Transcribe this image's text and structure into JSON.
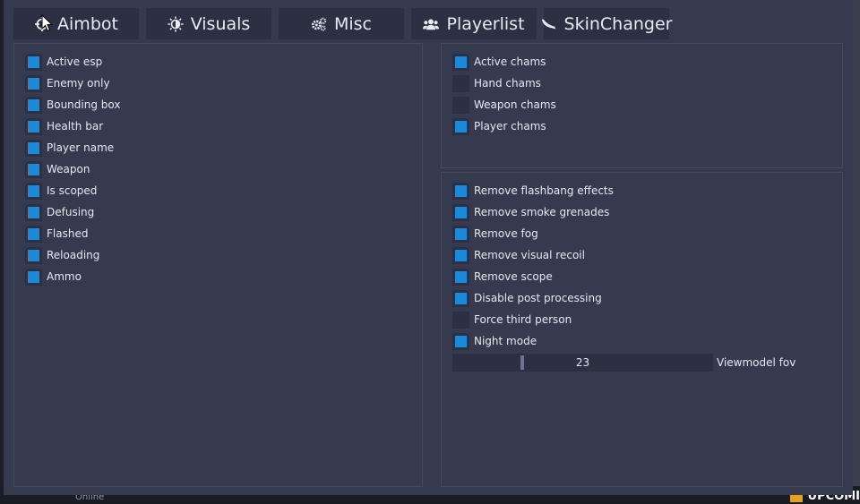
{
  "tabs": [
    {
      "label": "Aimbot",
      "icon": "crosshair-icon",
      "active": true
    },
    {
      "label": "Visuals",
      "icon": "sun-icon",
      "active": false
    },
    {
      "label": "Misc",
      "icon": "gears-icon",
      "active": false
    },
    {
      "label": "Playerlist",
      "icon": "users-icon",
      "active": false
    },
    {
      "label": "SkinChanger",
      "icon": "knife-icon",
      "active": false
    }
  ],
  "esp": [
    {
      "label": "Active esp",
      "checked": true
    },
    {
      "label": "Enemy only",
      "checked": true
    },
    {
      "label": "Bounding box",
      "checked": true
    },
    {
      "label": "Health bar",
      "checked": true
    },
    {
      "label": "Player name",
      "checked": true
    },
    {
      "label": "Weapon",
      "checked": true
    },
    {
      "label": "Is scoped",
      "checked": true
    },
    {
      "label": "Defusing",
      "checked": true
    },
    {
      "label": "Flashed",
      "checked": true
    },
    {
      "label": "Reloading",
      "checked": true
    },
    {
      "label": "Ammo",
      "checked": true
    }
  ],
  "chams": [
    {
      "label": "Active chams",
      "checked": true
    },
    {
      "label": "Hand chams",
      "checked": false
    },
    {
      "label": "Weapon chams",
      "checked": false
    },
    {
      "label": "Player chams",
      "checked": true
    }
  ],
  "removals": [
    {
      "label": "Remove flashbang effects",
      "checked": true
    },
    {
      "label": "Remove smoke grenades",
      "checked": true
    },
    {
      "label": "Remove fog",
      "checked": true
    },
    {
      "label": "Remove visual recoil",
      "checked": true
    },
    {
      "label": "Remove scope",
      "checked": true
    },
    {
      "label": "Disable post processing",
      "checked": true
    },
    {
      "label": "Force third person",
      "checked": false
    },
    {
      "label": "Night mode",
      "checked": true
    }
  ],
  "viewmodel_fov": {
    "label": "Viewmodel fov",
    "value": "23",
    "fraction": 0.26
  },
  "background": {
    "online": "Online",
    "upcoming": "UPCOMI"
  },
  "colors": {
    "accent": "#1596e6",
    "checkbox_fill": "#1a8ad9",
    "panel": "#363a4f",
    "control_bg": "#2c3042"
  }
}
